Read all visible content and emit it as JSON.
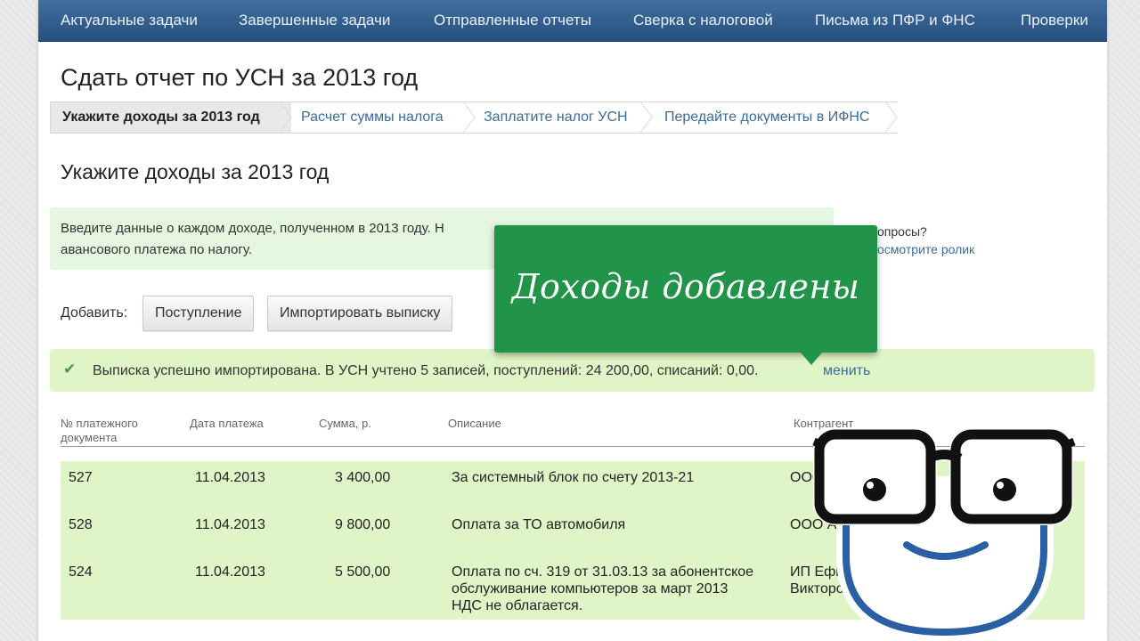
{
  "nav": {
    "items": [
      "Актуальные задачи",
      "Завершенные задачи",
      "Отправленные отчеты",
      "Сверка с налоговой",
      "Письма из ПФР и ФНС",
      "Проверки"
    ]
  },
  "page_title": "Сдать отчет по УСН за 2013 год",
  "steps": [
    "Укажите доходы за 2013 год",
    "Расчет суммы налога",
    "Заплатите налог УСН",
    "Передайте документы в ИФНС"
  ],
  "section_title": "Укажите доходы за 2013 год",
  "info": {
    "line1": "Введите данные о каждом доходе, полученном в 2013 году. Н",
    "line2": "авансового платежа по налогу."
  },
  "help": {
    "question": "опросы?",
    "video_link": "осмотрите ролик"
  },
  "add": {
    "label": "Добавить:",
    "income_button": "Поступление",
    "import_button": "Импортировать выписку"
  },
  "success": {
    "message": "Выписка успешно импортирована. В УСН учтено 5 записей, поступлений: 24 200,00, списаний: 0,00.",
    "link": "менить"
  },
  "table": {
    "headers": {
      "doc_no_1": "№ платежного",
      "doc_no_2": "документа",
      "date": "Дата платежа",
      "sum": "Сумма, р.",
      "description": "Описание",
      "counterparty": "Контрагент"
    },
    "rows": [
      {
        "doc": "527",
        "date": "11.04.2013",
        "sum": "3 400,00",
        "desc1": "За системный блок по счету 2013-21",
        "desc2": "",
        "desc3": "",
        "cp1": "ООО",
        "cp2": ""
      },
      {
        "doc": "528",
        "date": "11.04.2013",
        "sum": "9 800,00",
        "desc1": "Оплата за ТО автомобиля",
        "desc2": "",
        "desc3": "",
        "cp1": "ООО Ав",
        "cp2": ""
      },
      {
        "doc": "524",
        "date": "11.04.2013",
        "sum": "5 500,00",
        "desc1": "Оплата по сч. 319 от 31.03.13 за абонентское",
        "desc2": "обслуживание компьютеров за март 2013",
        "desc3": "НДС не облагается.",
        "cp1": "ИП Ефиме",
        "cp2": "Викторович"
      }
    ]
  },
  "tooltip_text": "Доходы добавлены",
  "colors": {
    "nav_bg": "#2d5a8a",
    "tooltip": "#21944a",
    "success_bg": "#e0f5c7",
    "info_bg": "#e6f7e1",
    "link": "#3a6c9c"
  }
}
